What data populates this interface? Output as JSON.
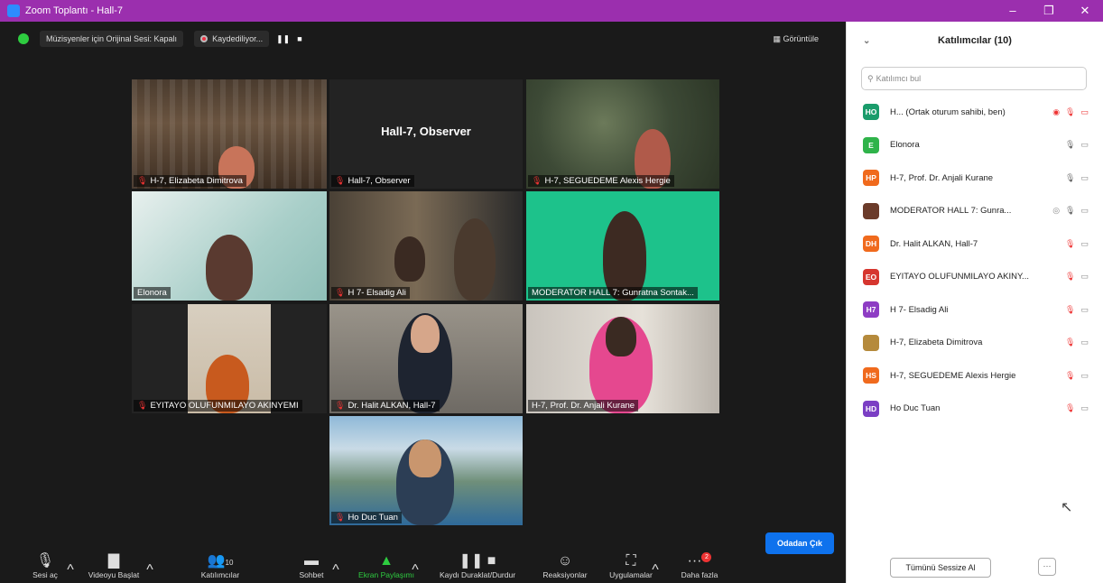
{
  "window": {
    "title": "Zoom Toplantı - Hall-7",
    "minimize": "–",
    "maximize": "❐",
    "close": "✕"
  },
  "topbar": {
    "audio_mode": "Müzisyenler için Orijinal Sesi: Kapalı",
    "recording": "Kaydediliyor...",
    "pause": "❚❚",
    "stop": "■",
    "view": "Görüntüle"
  },
  "tiles": [
    {
      "name": "H-7, Elizabeta Dimitrova",
      "muted": true
    },
    {
      "name": "Hall-7, Observer",
      "muted": true,
      "center": "Hall-7, Observer"
    },
    {
      "name": "H-7, SEGUEDEME Alexis Hergie",
      "muted": true
    },
    {
      "name": "Elonora",
      "muted": false
    },
    {
      "name": "H 7- Elsadig Ali",
      "muted": true
    },
    {
      "name": "MODERATOR HALL 7: Gunratna Sontak...",
      "muted": false
    },
    {
      "name": "EYITAYO OLUFUNMILAYO AKINYEMI",
      "muted": true
    },
    {
      "name": "Dr. Halit ALKAN, Hall-7",
      "muted": true
    },
    {
      "name": "H-7, Prof. Dr. Anjali Kurane",
      "muted": false
    },
    {
      "name": "Ho Duc Tuan",
      "muted": true
    }
  ],
  "toolbar": {
    "unmute": "Sesi aç",
    "start_video": "Videoyu Başlat",
    "participants": "Katılımcılar",
    "participants_count": "10",
    "chat": "Sohbet",
    "share_screen": "Ekran Paylaşımı",
    "pause_record": "Kaydı Duraklat/Durdur",
    "reactions": "Reaksiyonlar",
    "apps": "Uygulamalar",
    "more": "Daha fazla",
    "more_badge": "2",
    "leave": "Odadan Çık"
  },
  "panel": {
    "title": "Katılımcılar (10)",
    "search_placeholder": "Katılımcı bul",
    "participants": [
      {
        "initials": "HO",
        "name": "H... (Ortak oturum sahibi, ben)",
        "color": "#1a9c6b"
      },
      {
        "initials": "E",
        "name": "Elonora",
        "color": "#2fb34a"
      },
      {
        "initials": "HP",
        "name": "H-7, Prof. Dr. Anjali Kurane",
        "color": "#f06a1d"
      },
      {
        "initials": "",
        "name": "MODERATOR HALL 7: Gunra...",
        "color": "#6b3b2a"
      },
      {
        "initials": "DH",
        "name": "Dr. Halit ALKAN, Hall-7",
        "color": "#f06a1d"
      },
      {
        "initials": "EO",
        "name": "EYITAYO OLUFUNMILAYO AKINY...",
        "color": "#d6362f"
      },
      {
        "initials": "H7",
        "name": "H 7- Elsadig Ali",
        "color": "#8e3dc4"
      },
      {
        "initials": "",
        "name": "H-7, Elizabeta Dimitrova",
        "color": "#b58a3c"
      },
      {
        "initials": "HS",
        "name": "H-7, SEGUEDEME Alexis Hergie",
        "color": "#f06a1d"
      },
      {
        "initials": "HD",
        "name": "Ho Duc Tuan",
        "color": "#7b3fc4"
      }
    ],
    "mute_all": "Tümünü Sessize Al",
    "more": "···"
  }
}
